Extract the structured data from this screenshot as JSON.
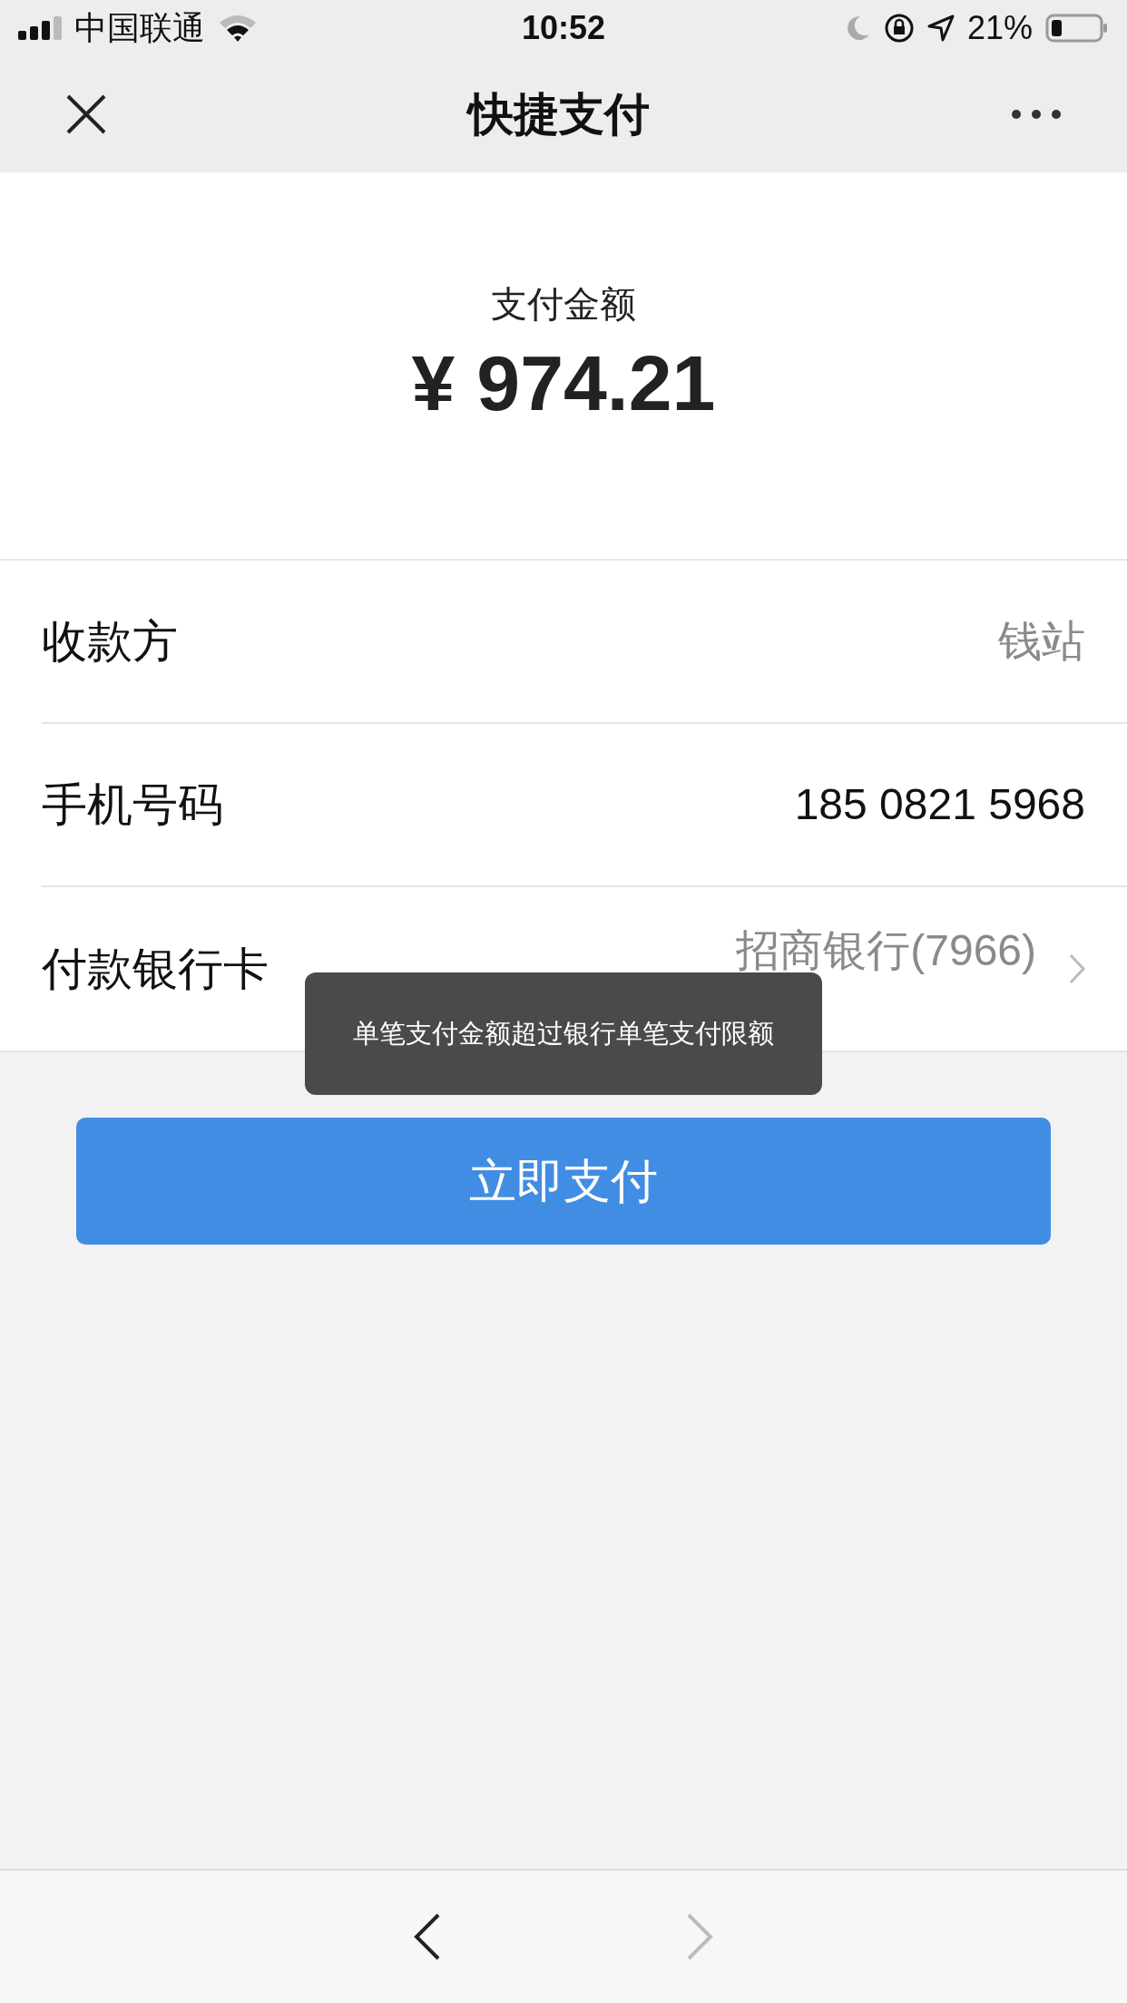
{
  "status_bar": {
    "carrier": "中国联通",
    "time": "10:52",
    "battery": "21%"
  },
  "nav": {
    "title": "快捷支付"
  },
  "amount": {
    "label": "支付金额",
    "value": "¥ 974.21"
  },
  "rows": [
    {
      "label": "收款方",
      "value": "钱站",
      "kind": "muted"
    },
    {
      "label": "手机号码",
      "value": "185 0821 5968",
      "kind": "plain"
    },
    {
      "label": "付款银行卡",
      "value": "招商银行(7966)",
      "kind": "link"
    }
  ],
  "toast": "单笔支付金额超过银行单笔支付限额",
  "pay_button": "立即支付",
  "toolbar": {
    "back_disabled": false,
    "forward_disabled": true
  }
}
